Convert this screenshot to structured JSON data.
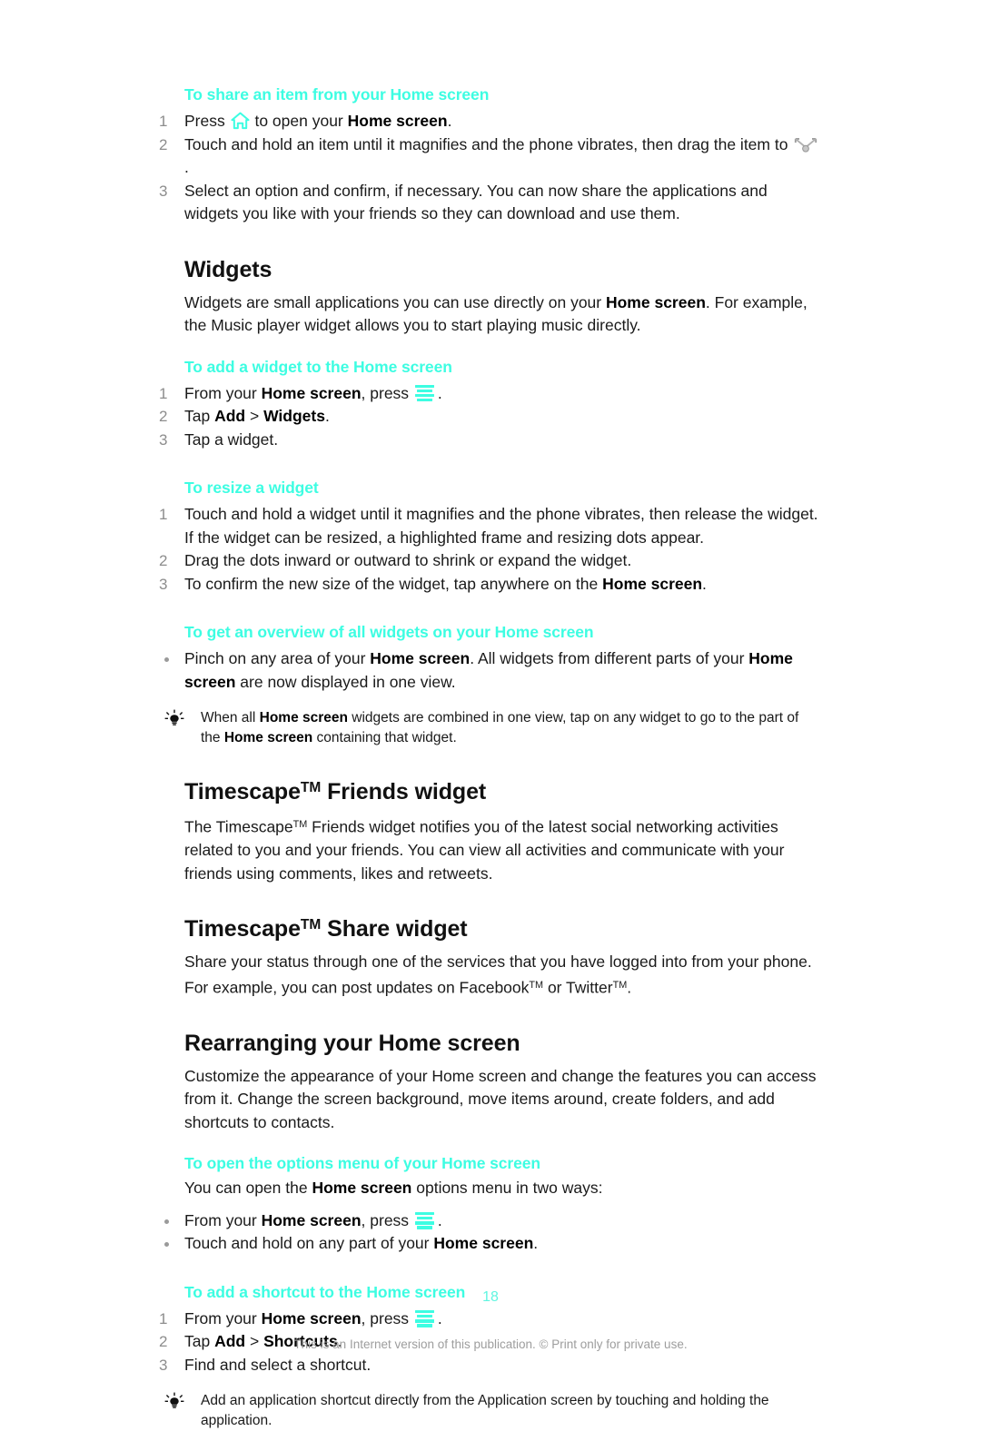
{
  "document": {
    "page_number": "18",
    "footer_note": "This is an Internet version of this publication. © Print only for private use.",
    "accent_color": "#3dfde2",
    "marker_color": "#8d8d8d"
  },
  "sections": {
    "share_item": {
      "heading": "To share an item from your Home screen",
      "steps": [
        {
          "num": "1",
          "prefix": "Press ",
          "icon": "home-icon",
          "mid": " to open your ",
          "bold": "Home screen",
          "suffix": "."
        },
        {
          "num": "2",
          "text_a": "Touch and hold an item until it magnifies and the phone vibrates, then drag the item to ",
          "icon": "share-icon",
          "text_b": "."
        },
        {
          "num": "3",
          "text_a": "Select an option and confirm, if necessary. You can now share the applications and widgets you like with your friends so they can download and use them."
        }
      ]
    },
    "widgets": {
      "heading": "Widgets",
      "intro_a": "Widgets are small applications you can use directly on your ",
      "intro_bold": "Home screen",
      "intro_b": ". For example, the Music player widget allows you to start playing music directly."
    },
    "add_widget": {
      "heading": "To add a widget to the Home screen",
      "steps": [
        {
          "num": "1",
          "prefix": "From your ",
          "bold": "Home screen",
          "mid": ", press ",
          "icon": "menu-icon",
          "suffix": "."
        },
        {
          "num": "2",
          "prefix": "Tap ",
          "bold": "Add",
          "mid": " > ",
          "bold2": "Widgets",
          "suffix": "."
        },
        {
          "num": "3",
          "text_a": "Tap a widget."
        }
      ]
    },
    "resize_widget": {
      "heading": "To resize a widget",
      "steps": [
        {
          "num": "1",
          "text_a": "Touch and hold a widget until it magnifies and the phone vibrates, then release the widget. If the widget can be resized, a highlighted frame and resizing dots appear."
        },
        {
          "num": "2",
          "text_a": "Drag the dots inward or outward to shrink or expand the widget."
        },
        {
          "num": "3",
          "prefix": "To confirm the new size of the widget, tap anywhere on the ",
          "bold": "Home screen",
          "suffix": "."
        }
      ]
    },
    "overview_widgets": {
      "heading": "To get an overview of all widgets on your Home screen",
      "bullets": [
        {
          "prefix": "Pinch on any area of your ",
          "bold": "Home screen",
          "mid": ". All widgets from different parts of your ",
          "bold2": "Home screen",
          "suffix": " are now displayed in one view."
        }
      ],
      "tip": {
        "icon": "lightbulb-icon",
        "prefix": "When all ",
        "bold": "Home screen",
        "mid": " widgets are combined in one view, tap on any widget to go to the part of the ",
        "bold2": "Home screen",
        "suffix": " containing that widget."
      }
    },
    "timescape_friends": {
      "heading_a": "Timescape",
      "heading_tm": "TM",
      "heading_b": " Friends widget",
      "body_a": "The Timescape",
      "body_tm": "TM",
      "body_b": " Friends widget notifies you of the latest social networking activities related to you and your friends. You can view all activities and communicate with your friends using comments, likes and retweets."
    },
    "timescape_share": {
      "heading_a": "Timescape",
      "heading_tm": "TM",
      "heading_b": " Share widget",
      "body_a": "Share your status through one of the services that you have logged into from your phone. For example, you can post updates on Facebook",
      "body_tm1": "TM",
      "body_mid": " or Twitter",
      "body_tm2": "TM",
      "body_end": "."
    },
    "rearranging": {
      "heading": "Rearranging your Home screen",
      "body": "Customize the appearance of your Home screen and change the features you can access from it. Change the screen background, move items around, create folders, and add shortcuts to contacts."
    },
    "options_menu": {
      "heading": "To open the options menu of your Home screen",
      "intro_a": "You can open the ",
      "intro_bold": "Home screen",
      "intro_b": " options menu in two ways:",
      "bullets": [
        {
          "prefix": "From your ",
          "bold": "Home screen",
          "mid": ", press ",
          "icon": "menu-icon",
          "suffix": "."
        },
        {
          "prefix": "Touch and hold on any part of your ",
          "bold": "Home screen",
          "suffix": "."
        }
      ]
    },
    "add_shortcut": {
      "heading": "To add a shortcut to the Home screen",
      "steps": [
        {
          "num": "1",
          "prefix": "From your ",
          "bold": "Home screen",
          "mid": ", press ",
          "icon": "menu-icon",
          "suffix": "."
        },
        {
          "num": "2",
          "prefix": "Tap ",
          "bold": "Add",
          "mid": " > ",
          "bold2": "Shortcuts",
          "suffix": "."
        },
        {
          "num": "3",
          "text_a": "Find and select a shortcut."
        }
      ],
      "tip": {
        "icon": "lightbulb-icon",
        "text": "Add an application shortcut directly from the Application screen by touching and holding the application."
      }
    }
  }
}
